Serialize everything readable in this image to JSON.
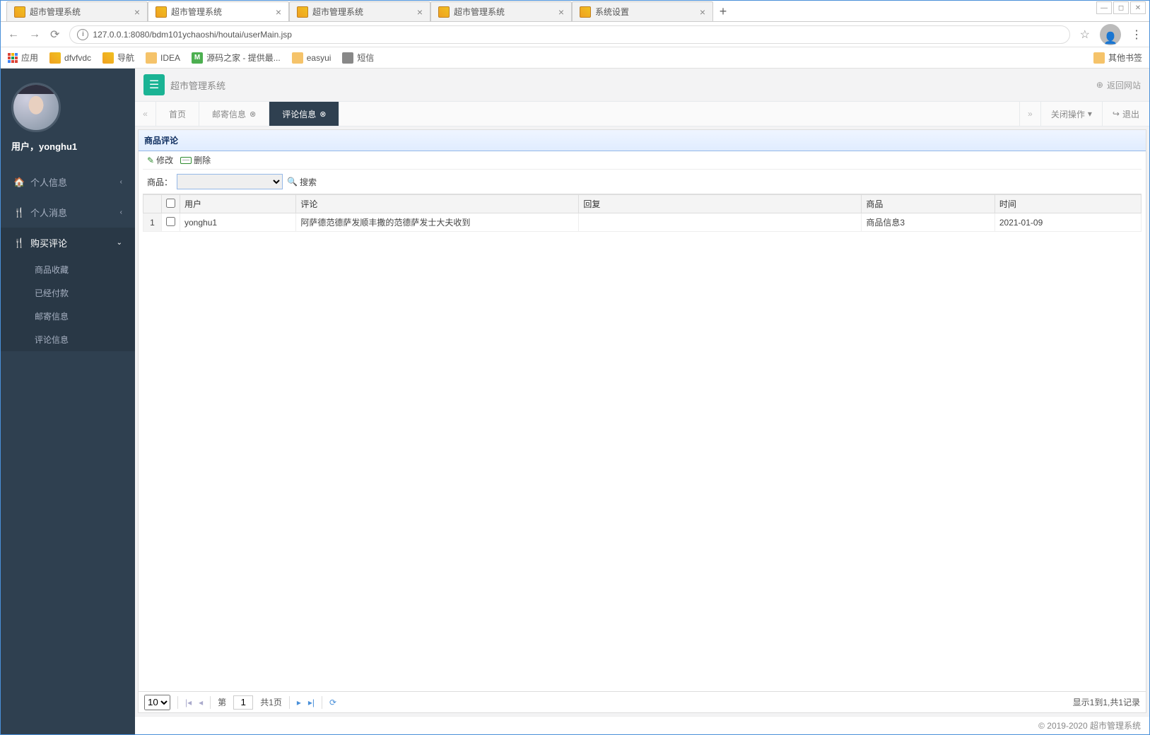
{
  "browser": {
    "tabs": [
      {
        "title": "超市管理系统"
      },
      {
        "title": "超市管理系统"
      },
      {
        "title": "超市管理系统"
      },
      {
        "title": "超市管理系统"
      },
      {
        "title": "系统设置"
      }
    ],
    "active_tab_index": 1,
    "url": "127.0.0.1:8080/bdm101ychaoshi/houtai/userMain.jsp",
    "bookmarks_label": "应用",
    "bookmarks": [
      {
        "label": "dfvfvdc"
      },
      {
        "label": "导航"
      },
      {
        "label": "IDEA"
      },
      {
        "label": "源码之家 - 提供最..."
      },
      {
        "label": "easyui"
      },
      {
        "label": "短信"
      }
    ],
    "other_bookmarks": "其他书签"
  },
  "sidebar": {
    "user_label": "用户，yonghu1",
    "menu": [
      {
        "icon": "🏠",
        "label": "个人信息",
        "chev": "‹"
      },
      {
        "icon": "🍴",
        "label": "个人消息",
        "chev": "‹"
      },
      {
        "icon": "🍴",
        "label": "购买评论",
        "chev": "⌄",
        "open": true
      }
    ],
    "submenu": [
      {
        "label": "商品收藏"
      },
      {
        "label": "已经付款"
      },
      {
        "label": "邮寄信息"
      },
      {
        "label": "评论信息"
      }
    ]
  },
  "topbar": {
    "title": "超市管理系统",
    "return": "返回网站"
  },
  "tabbar": {
    "tabs": [
      {
        "label": "首页",
        "closable": false
      },
      {
        "label": "邮寄信息",
        "closable": true
      },
      {
        "label": "评论信息",
        "closable": true
      }
    ],
    "active_index": 2,
    "close_ops": "关闭操作",
    "logout": "退出"
  },
  "panel": {
    "title": "商品评论",
    "toolbar": {
      "edit": "修改",
      "delete": "删除"
    },
    "search": {
      "label": "商品：",
      "button": "搜索",
      "value": ""
    },
    "columns": {
      "user": "用户",
      "comment": "评论",
      "reply": "回复",
      "product": "商品",
      "time": "时间"
    },
    "rows": [
      {
        "n": "1",
        "user": "yonghu1",
        "comment": "阿萨德范德萨发顺丰撒的范德萨发士大夫收到",
        "reply": "",
        "product": "商品信息3",
        "time": "2021-01-09"
      }
    ]
  },
  "pager": {
    "page_size": "10",
    "page_prefix": "第",
    "page_value": "1",
    "page_total": "共1页",
    "info": "显示1到1,共1记录"
  },
  "footer": {
    "copyright": "© 2019-2020 超市管理系统"
  }
}
